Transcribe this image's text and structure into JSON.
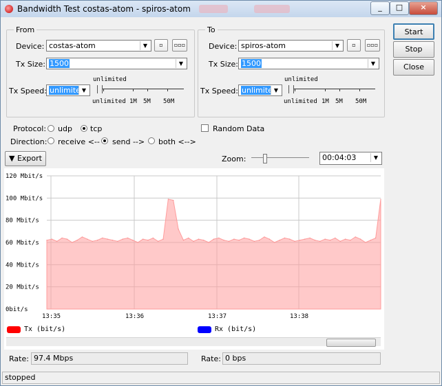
{
  "window": {
    "title": "Bandwidth Test costas-atom - spiros-atom"
  },
  "buttons": {
    "start": "Start",
    "stop": "Stop",
    "close": "Close",
    "export": "Export"
  },
  "from": {
    "legend": "From",
    "device_label": "Device:",
    "device_value": "costas-atom",
    "tx_size_label": "Tx Size:",
    "tx_size_value": "1500",
    "tx_speed_label": "Tx Speed:",
    "tx_speed_value": "unlimited"
  },
  "to": {
    "legend": "To",
    "device_label": "Device:",
    "device_value": "spiros-atom",
    "tx_size_label": "Tx Size:",
    "tx_size_value": "1500",
    "tx_speed_label": "Tx Speed:",
    "tx_speed_value": "unlimited"
  },
  "speed_scale": {
    "top": "unlimited",
    "ticks": [
      "unlimited",
      "1M",
      "5M",
      "50M"
    ]
  },
  "options": {
    "protocol_label": "Protocol:",
    "udp": "udp",
    "tcp": "tcp",
    "random_data": "Random Data",
    "direction_label": "Direction:",
    "receive": "receive <--",
    "send": "send -->",
    "both": "both <-->"
  },
  "zoom": {
    "label": "Zoom:",
    "value": "00:04:03"
  },
  "chart_data": {
    "type": "area",
    "y_tick_labels": [
      "120 Mbit/s",
      "100 Mbit/s",
      "80 Mbit/s",
      "60 Mbit/s",
      "40 Mbit/s",
      "20 Mbit/s",
      "0bit/s"
    ],
    "x_tick_labels": [
      "13:35",
      "13:36",
      "13:37",
      "13:38"
    ],
    "ylim": [
      0,
      120
    ],
    "series": [
      {
        "name": "Tx (bit/s)",
        "color": "#ff9c9c",
        "values": [
          62,
          63,
          61,
          64,
          63,
          60,
          62,
          65,
          63,
          61,
          62,
          64,
          63,
          62,
          61,
          63,
          64,
          62,
          60,
          63,
          62,
          64,
          61,
          63,
          99,
          98,
          72,
          62,
          64,
          61,
          63,
          62,
          60,
          63,
          64,
          62,
          61,
          63,
          62,
          64,
          63,
          61,
          62,
          65,
          63,
          60,
          62,
          64,
          63,
          61,
          62,
          63,
          64,
          62,
          61,
          63,
          62,
          64,
          61,
          63,
          62,
          65,
          63,
          60,
          62,
          64,
          99
        ]
      },
      {
        "name": "Rx (bit/s)",
        "color": "#0000ff",
        "values": []
      }
    ]
  },
  "rates": {
    "label": "Rate:",
    "left": "97.4 Mbps",
    "right": "0 bps"
  },
  "status": "stopped",
  "colors": {
    "accent": "#3399ff",
    "tx": "#ff0000",
    "rx": "#0000ff"
  }
}
